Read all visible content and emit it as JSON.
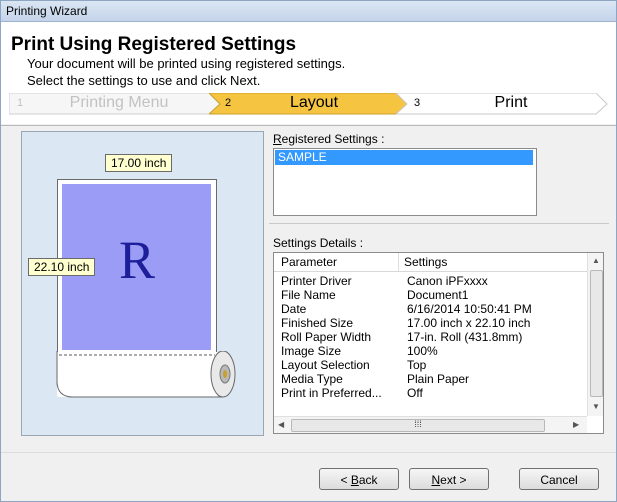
{
  "window": {
    "title": "Printing Wizard"
  },
  "header": {
    "title": "Print Using Registered Settings",
    "desc_line1": "Your document will be printed using registered settings.",
    "desc_line2": "Select the settings to use and click Next."
  },
  "steps": [
    {
      "num": "1",
      "label": "Printing Menu",
      "state": "done"
    },
    {
      "num": "2",
      "label": "Layout",
      "state": "current"
    },
    {
      "num": "3",
      "label": "Print",
      "state": "upcoming"
    }
  ],
  "preview": {
    "width_label": "17.00 inch",
    "height_label": "22.10 inch",
    "glyph": "R"
  },
  "registered": {
    "label": "Registered Settings :",
    "items": [
      "SAMPLE"
    ],
    "selected": "SAMPLE"
  },
  "details": {
    "label": "Settings Details :",
    "col_param": "Parameter",
    "col_settings": "Settings",
    "rows": [
      {
        "p": "Printer Driver",
        "v": "Canon iPFxxxx"
      },
      {
        "p": "File Name",
        "v": "Document1"
      },
      {
        "p": "Date",
        "v": "6/16/2014 10:50:41 PM"
      },
      {
        "p": "Finished Size",
        "v": "17.00 inch x 22.10 inch"
      },
      {
        "p": "Roll Paper Width",
        "v": "17-in. Roll (431.8mm)"
      },
      {
        "p": "Image Size",
        "v": "100%"
      },
      {
        "p": "Layout Selection",
        "v": "Top"
      },
      {
        "p": "Media Type",
        "v": "Plain Paper"
      },
      {
        "p": "Print in Preferred...",
        "v": "Off"
      }
    ]
  },
  "buttons": {
    "back_prefix": "< ",
    "back_key": "B",
    "back_rest": "ack",
    "next_key": "N",
    "next_rest": "ext >",
    "cancel": "Cancel"
  },
  "colors": {
    "step_current": "#f5c542",
    "selection": "#3399ff",
    "print_area": "#9a9cf6",
    "preview_bg": "#dbe8f4"
  }
}
